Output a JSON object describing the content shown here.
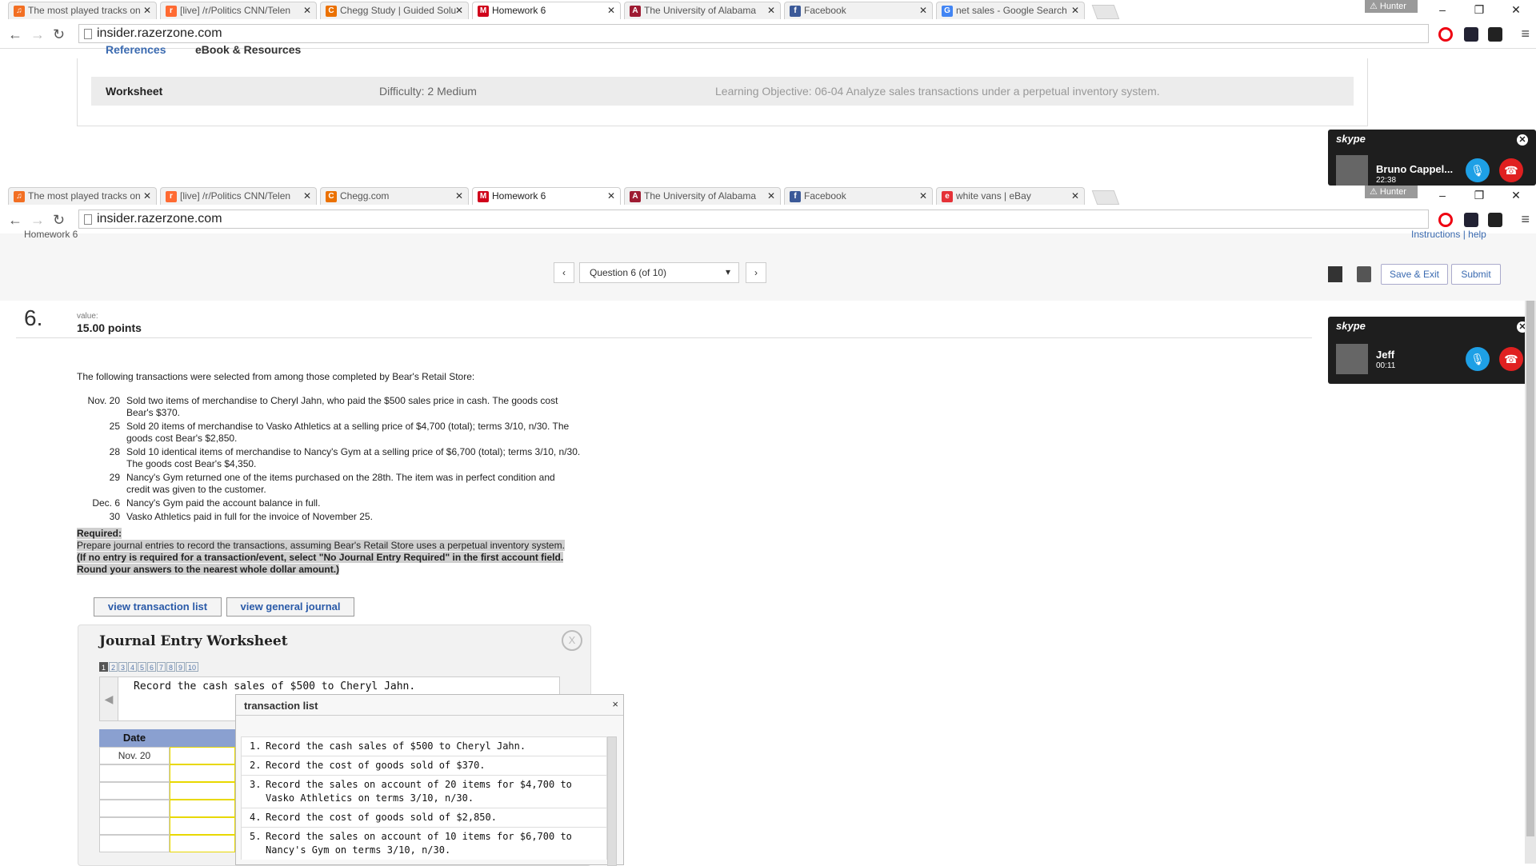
{
  "top_window": {
    "tabs": [
      {
        "label": "The most played tracks on",
        "fav": "soundcloud-icon",
        "color": "#f26f23"
      },
      {
        "label": "[live] /r/Politics CNN/Telen",
        "fav": "reddit-icon",
        "color": "#ff6a32"
      },
      {
        "label": "Chegg Study | Guided Solu",
        "fav": "chegg-icon",
        "color": "#eb7100"
      },
      {
        "label": "Homework 6",
        "fav": "mcgraw-hill-icon",
        "color": "#d0021b"
      },
      {
        "label": "The University of Alabama",
        "fav": "alabama-icon",
        "color": "#9e1b32"
      },
      {
        "label": "Facebook",
        "fav": "facebook-icon",
        "color": "#3b5998"
      },
      {
        "label": "net sales - Google Search",
        "fav": "google-icon",
        "color": "#4285f4"
      }
    ],
    "profile": "Hunter",
    "url": "insider.razerzone.com",
    "ref_tabs": [
      "References",
      "eBook & Resources"
    ],
    "worksheet": {
      "label": "Worksheet",
      "difficulty": "Difficulty: 2 Medium",
      "objective": "Learning Objective: 06-04 Analyze sales transactions under a perpetual inventory system."
    }
  },
  "skype_top": {
    "brand": "skype",
    "name": "Bruno Cappel...",
    "time": "22:38"
  },
  "bottom_window": {
    "tabs": [
      {
        "label": "The most played tracks on",
        "fav": "soundcloud-icon",
        "color": "#f26f23"
      },
      {
        "label": "[live] /r/Politics CNN/Telen",
        "fav": "reddit-icon",
        "color": "#ff6a32"
      },
      {
        "label": "Chegg.com",
        "fav": "chegg-icon",
        "color": "#eb7100"
      },
      {
        "label": "Homework 6",
        "fav": "mcgraw-hill-icon",
        "color": "#d0021b"
      },
      {
        "label": "The University of Alabama",
        "fav": "alabama-icon",
        "color": "#9e1b32"
      },
      {
        "label": "Facebook",
        "fav": "facebook-icon",
        "color": "#3b5998"
      },
      {
        "label": "white vans | eBay",
        "fav": "ebay-icon",
        "color": "#e53238"
      }
    ],
    "profile": "Hunter",
    "url": "insider.razerzone.com"
  },
  "skype_bottom": {
    "brand": "skype",
    "name": "Jeff",
    "time": "00:11"
  },
  "page": {
    "crumb_top": "Homework 6",
    "crumb_right": "Instructions | help",
    "question_select": "Question 6 (of 10)",
    "save_exit": "Save & Exit",
    "submit": "Submit",
    "question_number": "6.",
    "value_label": "value:",
    "value_points": "15.00 points",
    "intro": "The following transactions were selected from among those completed by Bear's Retail Store:",
    "transactions": [
      {
        "date": "Nov. 20",
        "text": "Sold two items of merchandise to Cheryl Jahn, who paid the $500 sales price in cash. The goods cost Bear's $370."
      },
      {
        "date": "25",
        "text": "Sold 20 items of merchandise to Vasko Athletics at a selling price of $4,700 (total); terms 3/10, n/30. The goods cost Bear's $2,850."
      },
      {
        "date": "28",
        "text": "Sold 10 identical items of merchandise to Nancy's Gym at a selling price of $6,700 (total); terms 3/10, n/30. The goods cost Bear's $4,350."
      },
      {
        "date": "29",
        "text": "Nancy's Gym returned one of the items purchased on the 28th. The item was in perfect condition and credit was given to the customer."
      },
      {
        "date": "Dec. 6",
        "text": "Nancy's Gym paid the account balance in full."
      },
      {
        "date": "30",
        "text": "Vasko Athletics paid in full for the invoice of November 25."
      }
    ],
    "required_label": "Required:",
    "required_text": "Prepare journal entries to record the transactions, assuming Bear's Retail Store uses a perpetual inventory system.",
    "required_bold": "(If no entry is required for a transaction/event, select \"No Journal Entry Required\" in the first account field. Round your answers to the nearest whole dollar amount.)",
    "btn_transaction_list": "view transaction list",
    "btn_general_journal": "view general journal"
  },
  "worksheet_modal": {
    "title": "Journal Entry Worksheet",
    "close": "X",
    "pages": [
      "1",
      "2",
      "3",
      "4",
      "5",
      "6",
      "7",
      "8",
      "9",
      "10"
    ],
    "current_text": "Record the cash sales of $500 to Cheryl Jahn.",
    "col_date": "Date",
    "first_date": "Nov. 20"
  },
  "transaction_list": {
    "title": "transaction list",
    "close": "×",
    "items": [
      {
        "n": "1.",
        "text": "Record the cash sales of $500 to Cheryl Jahn."
      },
      {
        "n": "2.",
        "text": "Record the cost of goods sold of $370."
      },
      {
        "n": "3.",
        "text": "Record the sales on account of 20 items for $4,700 to Vasko Athletics on terms 3/10, n/30."
      },
      {
        "n": "4.",
        "text": "Record the cost of goods sold of $2,850."
      },
      {
        "n": "5.",
        "text": "Record the sales on account of 10 items for $6,700 to Nancy's Gym on terms 3/10, n/30."
      }
    ]
  }
}
